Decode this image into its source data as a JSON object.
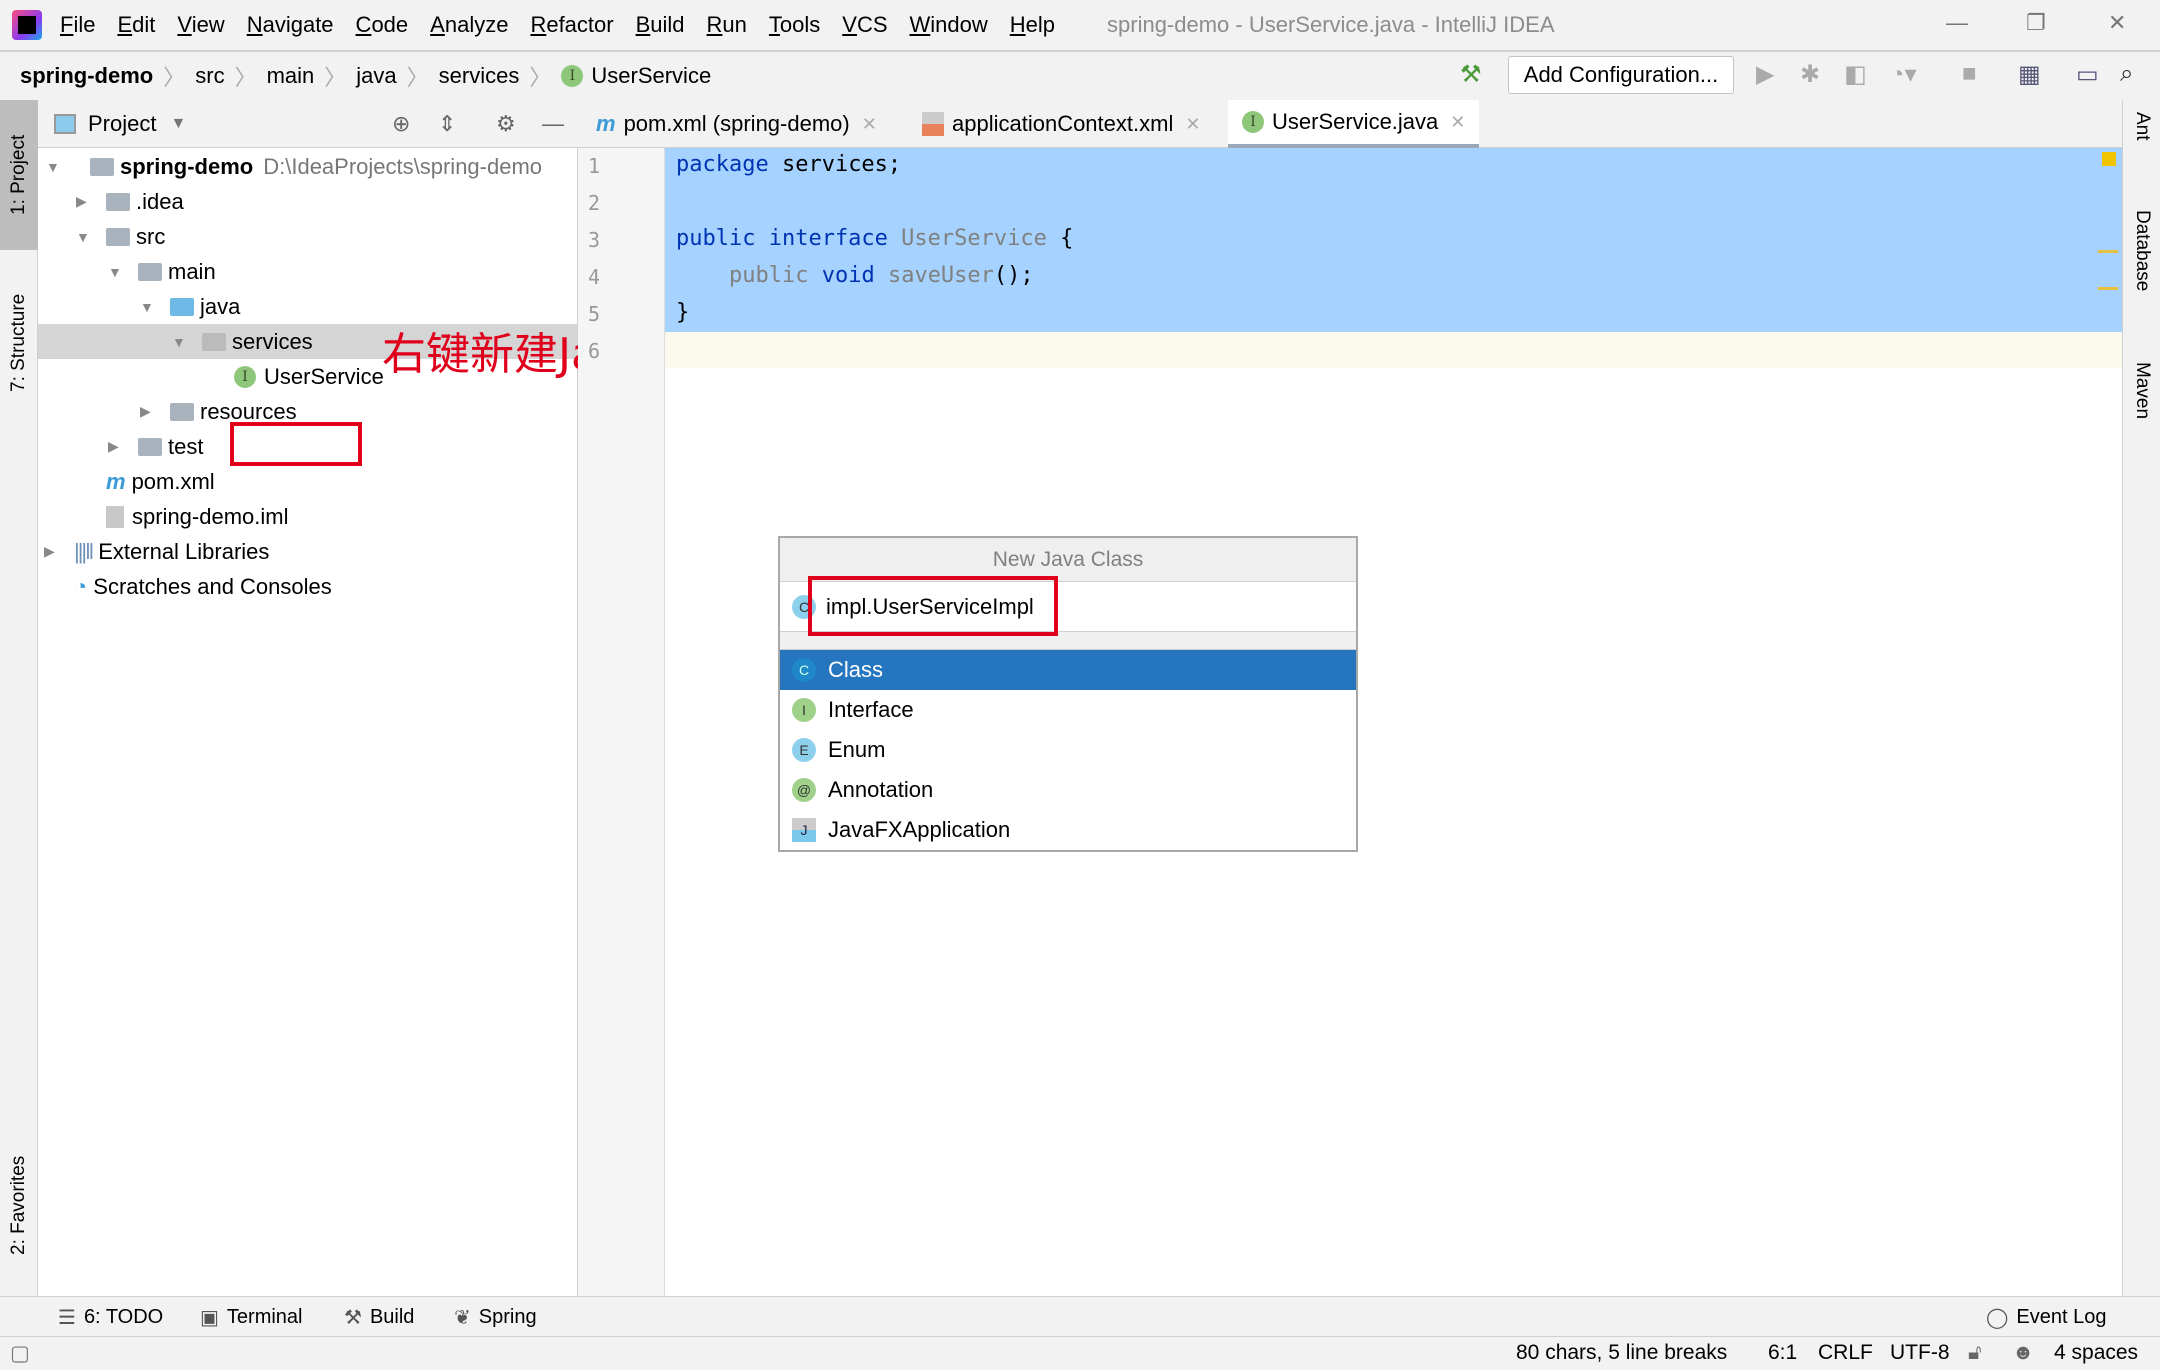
{
  "window": {
    "title": "spring-demo - UserService.java - IntelliJ IDEA"
  },
  "menu": [
    "File",
    "Edit",
    "View",
    "Navigate",
    "Code",
    "Analyze",
    "Refactor",
    "Build",
    "Run",
    "Tools",
    "VCS",
    "Window",
    "Help"
  ],
  "breadcrumb": [
    "spring-demo",
    "src",
    "main",
    "java",
    "services",
    "UserService"
  ],
  "toolbar": {
    "add_configuration": "Add Configuration..."
  },
  "left_stripe": {
    "project": "1: Project",
    "structure": "7: Structure",
    "favorites": "2: Favorites"
  },
  "right_stripe": {
    "ant": "Ant",
    "database": "Database",
    "maven": "Maven"
  },
  "project_panel": {
    "title": "Project",
    "tree": [
      {
        "label": "spring-demo",
        "path": "D:\\IdeaProjects\\spring-demo"
      },
      {
        "label": ".idea"
      },
      {
        "label": "src"
      },
      {
        "label": "main"
      },
      {
        "label": "java"
      },
      {
        "label": "services"
      },
      {
        "label": "UserService"
      },
      {
        "label": "resources"
      },
      {
        "label": "test"
      },
      {
        "label": "pom.xml"
      },
      {
        "label": "spring-demo.iml"
      },
      {
        "label": "External Libraries"
      },
      {
        "label": "Scratches and Consoles"
      }
    ]
  },
  "annotation": "右键新建Java文件",
  "tabs": [
    {
      "label": "pom.xml (spring-demo)"
    },
    {
      "label": "applicationContext.xml"
    },
    {
      "label": "UserService.java",
      "active": true
    }
  ],
  "editor": {
    "line_numbers": [
      "1",
      "2",
      "3",
      "4",
      "5",
      "6"
    ]
  },
  "dialog": {
    "title": "New Java Class",
    "input_value": "impl.UserServiceImpl",
    "options": [
      {
        "label": "Class",
        "badge": "C",
        "selected": true
      },
      {
        "label": "Interface",
        "badge": "I"
      },
      {
        "label": "Enum",
        "badge": "E"
      },
      {
        "label": "Annotation",
        "badge": "@"
      },
      {
        "label": "JavaFXApplication",
        "badge": "J"
      }
    ]
  },
  "tool_windows": {
    "todo": "6: TODO",
    "terminal": "Terminal",
    "build": "Build",
    "spring": "Spring",
    "event_log": "Event Log"
  },
  "status": {
    "chars": "80 chars, 5 line breaks",
    "position": "6:1",
    "line_sep": "CRLF",
    "encoding": "UTF-8",
    "indent": "4 spaces"
  },
  "colors": {
    "selection": "#a6d2ff",
    "dialog_selected": "#2675bf",
    "annotation": "#e0001b"
  }
}
